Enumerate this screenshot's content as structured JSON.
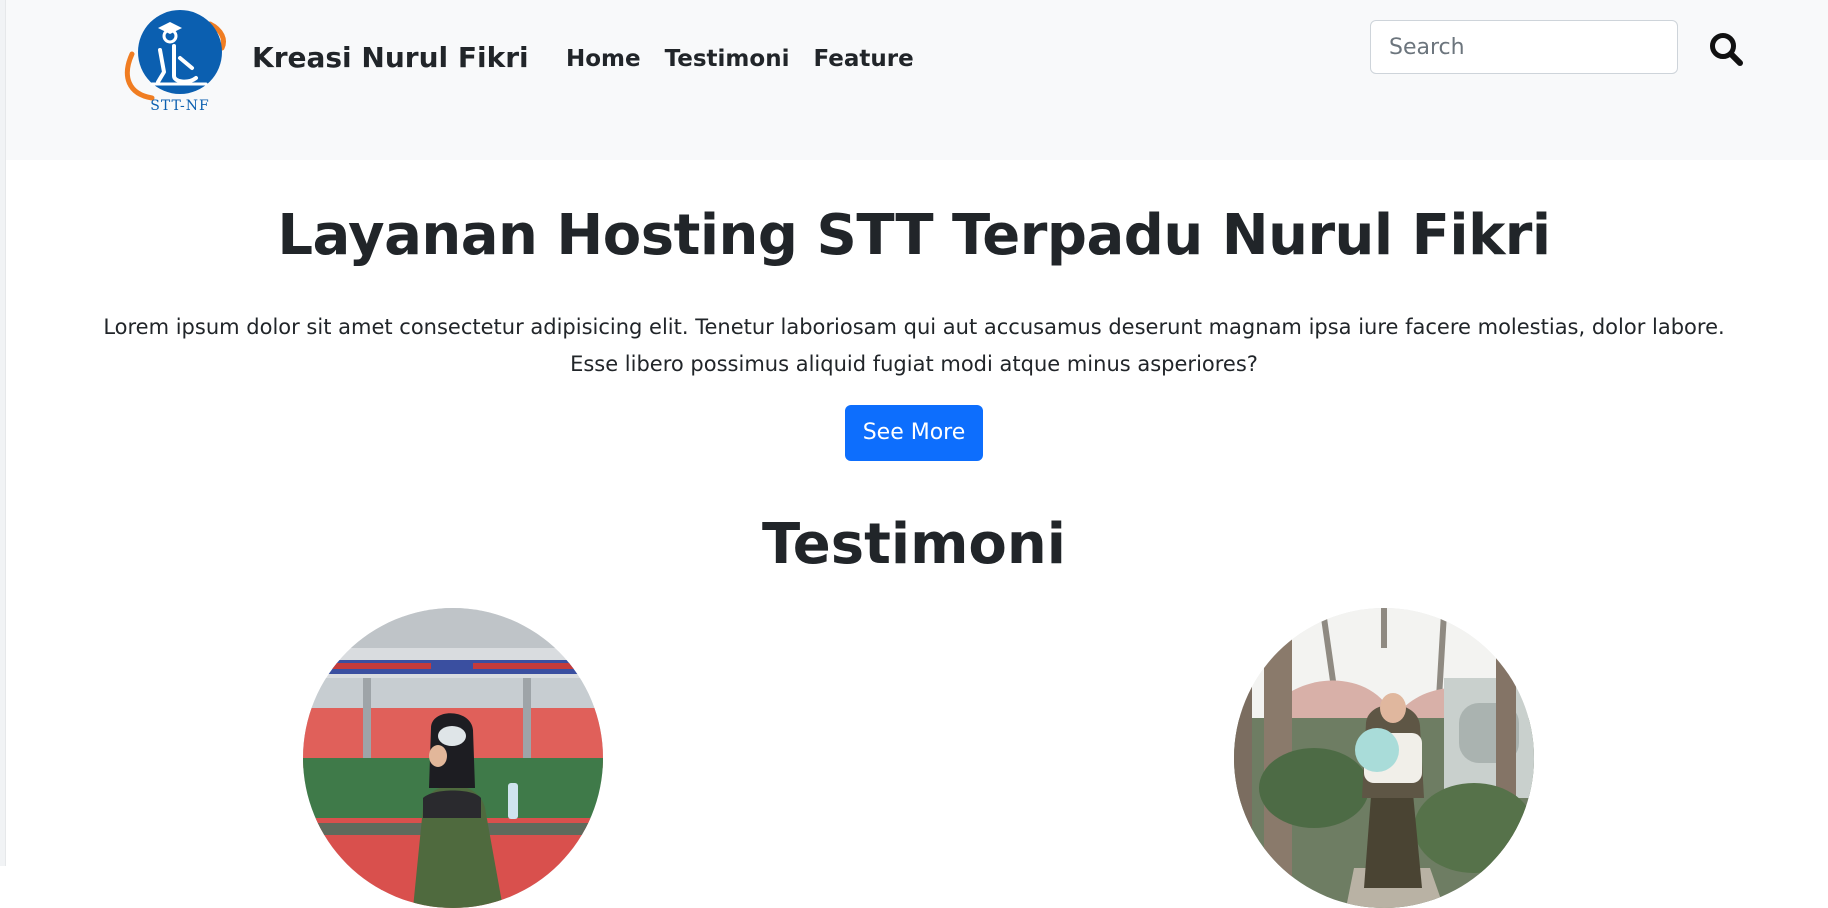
{
  "brand": {
    "name": "Kreasi Nurul Fikri",
    "logo_caption": "STT-NF",
    "logo_icon": "graduate-figure-logo"
  },
  "nav": {
    "items": [
      {
        "label": "Home"
      },
      {
        "label": "Testimoni"
      },
      {
        "label": "Feature"
      }
    ]
  },
  "search": {
    "placeholder": "Search",
    "value": "",
    "button_icon": "search-icon"
  },
  "hero": {
    "title": "Layanan Hosting STT Terpadu Nurul Fikri",
    "text_line1": "Lorem ipsum dolor sit amet consectetur adipisicing elit. Tenetur laboriosam qui aut accusamus deserunt magnam ipsa iure facere molestias, dolor labore.",
    "text_line2": "Esse libero possimus aliquid fugiat modi atque minus asperiores?",
    "cta_label": "See More"
  },
  "testimoni": {
    "title": "Testimoni",
    "avatars": [
      {
        "icon": "testimonial-photo-train-station"
      },
      {
        "icon": "testimonial-photo-garden"
      }
    ]
  },
  "colors": {
    "primary": "#0d6efd",
    "navbar_bg": "#f8f9fa",
    "text": "#212529",
    "logo_blue": "#0b5fb0",
    "logo_orange": "#f07d22"
  }
}
